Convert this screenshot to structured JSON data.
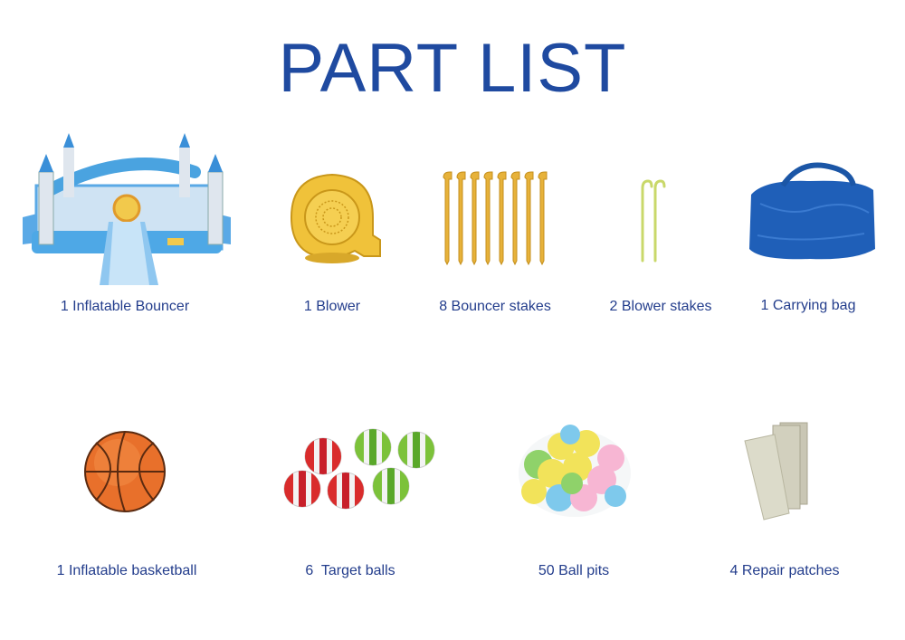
{
  "title": "PART LIST",
  "items": [
    {
      "label": "1 Inflatable Bouncer",
      "icon": "bouncer-castle-icon"
    },
    {
      "label": "1 Blower",
      "icon": "blower-icon"
    },
    {
      "label": "8 Bouncer stakes",
      "icon": "bouncer-stakes-icon"
    },
    {
      "label": "2 Blower stakes",
      "icon": "blower-stakes-icon"
    },
    {
      "label": "1 Carrying bag",
      "icon": "carrying-bag-icon"
    },
    {
      "label": "1 Inflatable basketball",
      "icon": "basketball-icon"
    },
    {
      "label": "6  Target balls",
      "icon": "target-balls-icon"
    },
    {
      "label": "50 Ball pits",
      "icon": "ball-pit-icon"
    },
    {
      "label": "4 Repair patches",
      "icon": "repair-patches-icon"
    }
  ],
  "colors": {
    "title": "#1f4aa0",
    "label": "#233d8c"
  }
}
